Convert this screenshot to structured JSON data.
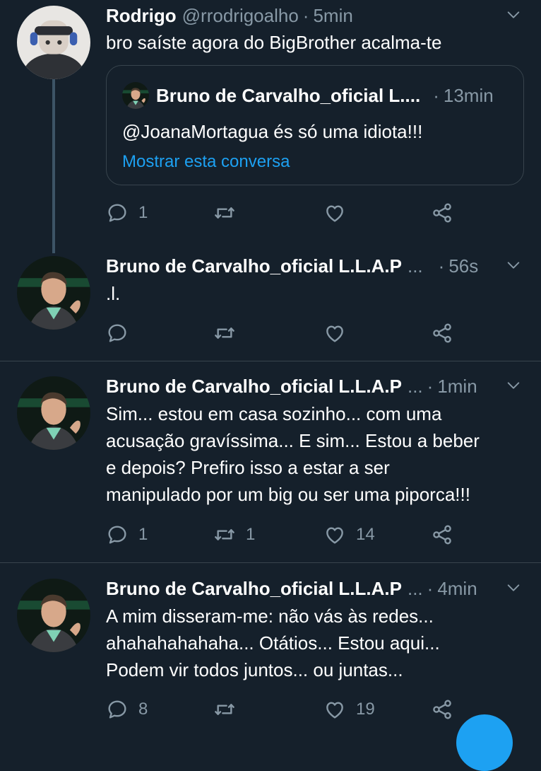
{
  "colors": {
    "background": "#15202b",
    "divider": "#38444d",
    "secondary_text": "#8899a6",
    "link": "#1da1f2"
  },
  "tweets": [
    {
      "name": "Rodrigo",
      "handle": "@rrodrigoalho",
      "dot": "·",
      "time": "5min",
      "text": "bro saíste agora do BigBrother acalma-te",
      "quote": {
        "name": "Bruno de Carvalho_oficial L....",
        "dot": "·",
        "time": "13min",
        "text": "@JoanaMortagua és só uma idiota!!!",
        "link": "Mostrar esta conversa"
      },
      "reply_count": "1",
      "retweet_count": "",
      "like_count": ""
    },
    {
      "name": "Bruno de Carvalho_oficial L.L.A.P",
      "ellipsis": "...",
      "dot": "·",
      "time": "56s",
      "text": ".l.",
      "reply_count": "",
      "retweet_count": "",
      "like_count": ""
    },
    {
      "name": "Bruno de Carvalho_oficial L.L.A.P",
      "ellipsis": "...",
      "dot": "·",
      "time": "1min",
      "text_lines": [
        "Sim... estou em casa sozinho... com uma",
        "acusação gravíssima... E sim... Estou a beber",
        "e depois? Prefiro isso a estar a ser",
        "manipulado por um big ou ser uma piporca!!!"
      ],
      "reply_count": "1",
      "retweet_count": "1",
      "like_count": "14"
    },
    {
      "name": "Bruno de Carvalho_oficial L.L.A.P",
      "ellipsis": "...",
      "dot": "·",
      "time": "4min",
      "text_lines": [
        "A mim disseram-me: não vás às redes...",
        "ahahahahahaha... Otátios... Estou aqui...",
        "Podem vir todos juntos... ou juntas..."
      ],
      "reply_count": "8",
      "retweet_count": "",
      "like_count": "19"
    }
  ],
  "icons": {
    "reply": "reply-icon",
    "retweet": "retweet-icon",
    "like": "heart-icon",
    "share": "share-icon",
    "menu": "chevron-down-icon"
  }
}
